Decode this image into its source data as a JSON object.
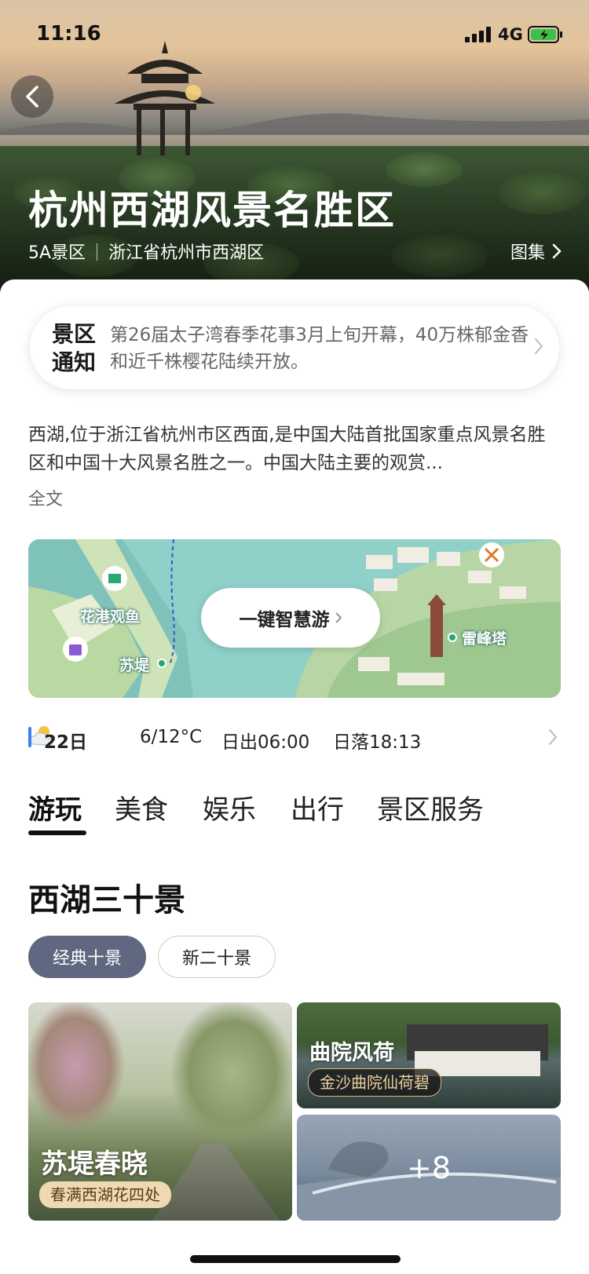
{
  "status_bar": {
    "time": "11:16",
    "network": "4G"
  },
  "header": {
    "title": "杭州西湖风景名胜区",
    "level": "5A景区",
    "location": "浙江省杭州市西湖区",
    "gallery_label": "图集"
  },
  "notice": {
    "tag_line1": "景区",
    "tag_line2": "通知",
    "text": "第26届太子湾春季花事3月上旬开幕，40万株郁金香和近千株樱花陆续开放。"
  },
  "description": {
    "text": "西湖,位于浙江省杭州市区西面,是中国大陆首批国家重点风景名胜区和中国十大风景名胜之一。中国大陆主要的观赏...",
    "more_label": "全文"
  },
  "map": {
    "button_label": "一键智慧游",
    "labels": [
      "花港观鱼",
      "苏堤",
      "雷峰塔"
    ]
  },
  "weather": {
    "date": "22日",
    "temperature": "6/12°C",
    "sunrise": "日出06:00",
    "sunset": "日落18:13"
  },
  "tabs": [
    "游玩",
    "美食",
    "娱乐",
    "出行",
    "景区服务"
  ],
  "section": {
    "title": "西湖三十景",
    "chips": [
      "经典十景",
      "新二十景"
    ]
  },
  "cards": {
    "big": {
      "title": "苏堤春晓",
      "tag": "春满西湖花四处"
    },
    "small1": {
      "title": "曲院风荷",
      "tag": "金沙曲院仙荷碧"
    },
    "small2": {
      "more": "+8"
    }
  }
}
